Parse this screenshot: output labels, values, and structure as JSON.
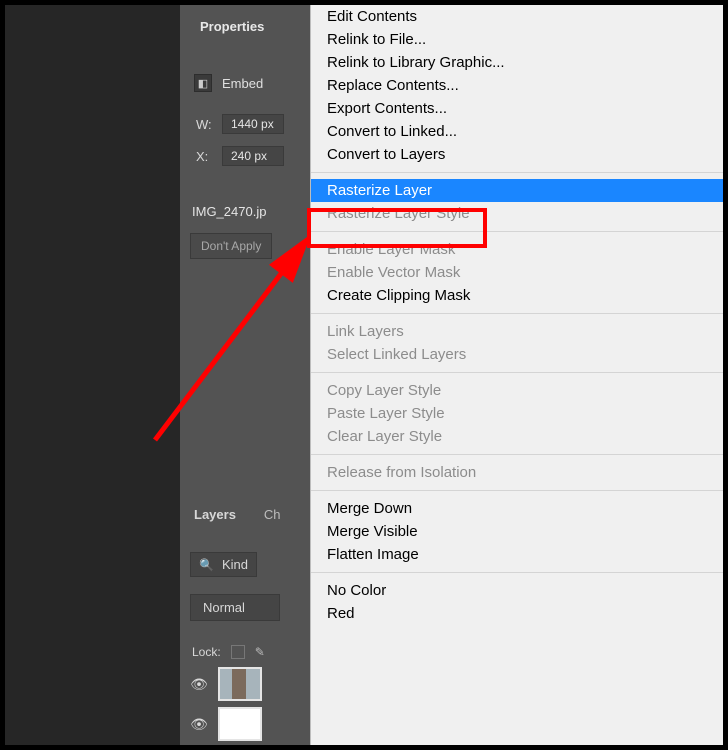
{
  "panel": {
    "title": "Properties",
    "embed_label": "Embed",
    "w_label": "W:",
    "w_value": "1440 px",
    "x_label": "X:",
    "x_value": "240 px",
    "filename": "IMG_2470.jp",
    "dont_apply": "Don't Apply",
    "tab_layers": "Layers",
    "tab_channels": "Ch",
    "kind_label": "Kind",
    "blend_mode": "Normal",
    "lock_label": "Lock:"
  },
  "menu": {
    "groups": [
      {
        "items": [
          {
            "label": "Edit Contents",
            "enabled": true
          },
          {
            "label": "Relink to File...",
            "enabled": true
          },
          {
            "label": "Relink to Library Graphic...",
            "enabled": true
          },
          {
            "label": "Replace Contents...",
            "enabled": true
          },
          {
            "label": "Export Contents...",
            "enabled": true
          },
          {
            "label": "Convert to Linked...",
            "enabled": true
          },
          {
            "label": "Convert to Layers",
            "enabled": true
          }
        ]
      },
      {
        "items": [
          {
            "label": "Rasterize Layer",
            "enabled": true,
            "highlight": true
          },
          {
            "label": "Rasterize Layer Style",
            "enabled": false
          }
        ]
      },
      {
        "items": [
          {
            "label": "Enable Layer Mask",
            "enabled": false
          },
          {
            "label": "Enable Vector Mask",
            "enabled": false
          },
          {
            "label": "Create Clipping Mask",
            "enabled": true
          }
        ]
      },
      {
        "items": [
          {
            "label": "Link Layers",
            "enabled": false
          },
          {
            "label": "Select Linked Layers",
            "enabled": false
          }
        ]
      },
      {
        "items": [
          {
            "label": "Copy Layer Style",
            "enabled": false
          },
          {
            "label": "Paste Layer Style",
            "enabled": false
          },
          {
            "label": "Clear Layer Style",
            "enabled": false
          }
        ]
      },
      {
        "items": [
          {
            "label": "Release from Isolation",
            "enabled": false
          }
        ]
      },
      {
        "items": [
          {
            "label": "Merge Down",
            "enabled": true
          },
          {
            "label": "Merge Visible",
            "enabled": true
          },
          {
            "label": "Flatten Image",
            "enabled": true
          }
        ]
      },
      {
        "items": [
          {
            "label": "No Color",
            "enabled": true
          },
          {
            "label": "Red",
            "enabled": true
          }
        ]
      }
    ]
  }
}
